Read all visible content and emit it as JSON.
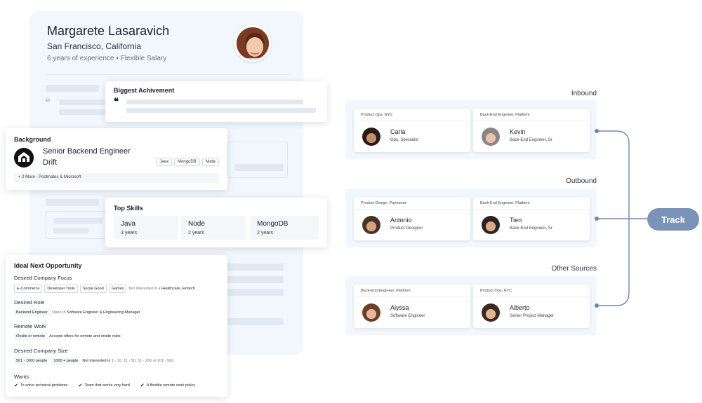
{
  "profile": {
    "name": "Margarete Lasaravich",
    "location": "San Francisco, California",
    "experience": "6 years of experience",
    "salary": "Flexible Salary",
    "separator": "•"
  },
  "achievement": {
    "title": "Biggest Achivement",
    "quote_glyph": "❝"
  },
  "background": {
    "title": "Background",
    "role": "Senior Backend Engineer",
    "company": "Drift",
    "tags": [
      "Java",
      "MongoDB",
      "Node"
    ],
    "more": "+ 2 More - Postmates & Microsoft"
  },
  "skills": {
    "title": "Top Skills",
    "items": [
      {
        "name": "Java",
        "years": "3 years"
      },
      {
        "name": "Node",
        "years": "2 years"
      },
      {
        "name": "MongoDB",
        "years": "2 years"
      }
    ]
  },
  "ideal": {
    "title": "Ideal Next Opportunity",
    "company_focus": {
      "label": "Desired Company Focus",
      "chips": [
        "E-Commerce",
        "Developer Tools",
        "Social Good",
        "Games"
      ],
      "not_interested_prefix": "Not Interested in a",
      "not_interested_value": "Healthcare, Fintech"
    },
    "role": {
      "label": "Desired Role",
      "chip": "Backend Engineer",
      "open_prefix": "Open to",
      "open_value": "Software Engineer & Engineering Manager"
    },
    "remote": {
      "label": "Remote Work",
      "chip": "Onsite or remote",
      "note": "Accepts offers for remote and onsite roles"
    },
    "size": {
      "label": "Desired Company Size",
      "chips": [
        "501 - 1000 people",
        "1000 + people"
      ],
      "not_interested_prefix": "Not interested in",
      "not_interested_value": "1 - 10, 11 - 50, 51 - 200 or 201 - 500"
    },
    "wants": {
      "label": "Wants",
      "items": [
        "To solve technical problems",
        "Team that works very hard",
        "A flexible remote work policy"
      ]
    }
  },
  "groups": [
    {
      "label": "Inbound",
      "people": [
        {
          "team": "Product Ops, NYC",
          "name": "Carla",
          "title": "Ops, Specialist"
        },
        {
          "team": "Back-End Engineer, Platform",
          "name": "Kevin",
          "title": "Back-End Engineer, Sr"
        }
      ]
    },
    {
      "label": "Outbound",
      "people": [
        {
          "team": "Product Design, Payments",
          "name": "Antonio",
          "title": "Product Designer"
        },
        {
          "team": "Back-End Engineer, Platform",
          "name": "Tien",
          "title": "Back-End Engineer, Sr"
        }
      ]
    },
    {
      "label": "Other Sources",
      "people": [
        {
          "team": "Back-End Engineer, Platform",
          "name": "Alyssa",
          "title": "Software Engineer"
        },
        {
          "team": "Product Ops, NYC",
          "name": "Alberto",
          "title": "Senior Project Manager"
        }
      ]
    }
  ],
  "track": {
    "label": "Track"
  },
  "colors": {
    "accent": "#7b93b8",
    "card_bg": "#f2f6fd",
    "connector": "#6f86ad"
  },
  "icons": {
    "check": "✔"
  }
}
